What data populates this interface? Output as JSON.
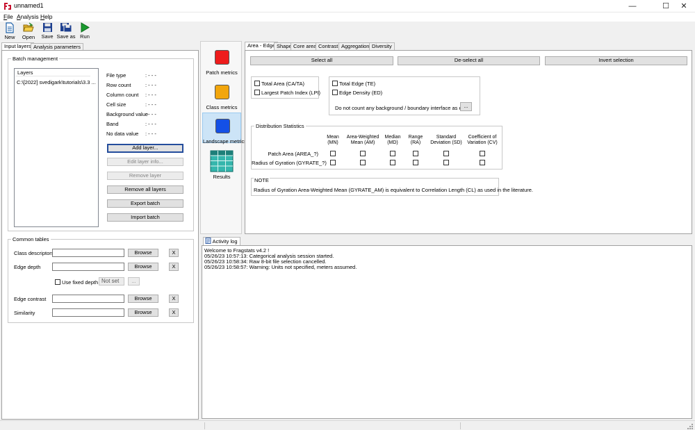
{
  "window": {
    "title": "unnamed1",
    "controls": {
      "minimize": "—",
      "maximize": "☐",
      "close": "✕"
    }
  },
  "menu": [
    {
      "key": "F",
      "rest": "ile"
    },
    {
      "key": "A",
      "rest": "nalysis"
    },
    {
      "key": "H",
      "rest": "elp"
    }
  ],
  "toolbar": {
    "new": "New",
    "open": "Open",
    "save": "Save",
    "save_as": "Save as",
    "run": "Run"
  },
  "left_tabs": {
    "input_layers": "Input layers",
    "analysis_parameters": "Analysis parameters"
  },
  "batch": {
    "title": "Batch management",
    "layers_header": "Layers",
    "layer_path": "C:\\[2022] svedigark\\tutorials\\3.3 ...",
    "info": [
      {
        "label": "File type",
        "value": ": - - -"
      },
      {
        "label": "Row count",
        "value": ": - - -"
      },
      {
        "label": "Column count",
        "value": ": - - -"
      },
      {
        "label": "Cell size",
        "value": ": - - -"
      },
      {
        "label": "Background value",
        "value": ": - - -"
      },
      {
        "label": "Band",
        "value": ": - - -"
      },
      {
        "label": "No data value",
        "value": ": - - -"
      }
    ],
    "buttons": {
      "add_layer": "Add layer...",
      "edit_layer_info": "Edit layer info...",
      "remove_layer": "Remove layer",
      "remove_all_layers": "Remove all layers",
      "export_batch": "Export batch",
      "import_batch": "Import batch"
    }
  },
  "common": {
    "title": "Common tables",
    "class_descriptors": "Class descriptors",
    "edge_depth": "Edge depth",
    "use_fixed_depth": "Use fixed depth",
    "not_set": "Not set",
    "ellipsis": "...",
    "edge_contrast": "Edge contrast",
    "similarity": "Similarity",
    "browse": "Browse",
    "clear": "X"
  },
  "side": {
    "patch": "Patch metrics",
    "class": "Class metrics",
    "landscape": "Landscape metrics",
    "results": "Results"
  },
  "colors": {
    "patch": "#ee1c1c",
    "class": "#f2a60d",
    "landscape": "#1450e6",
    "results": "#1d9a92",
    "selection": "#cce4f7"
  },
  "metric_tabs": [
    "Area - Edge",
    "Shape",
    "Core area",
    "Contrast",
    "Aggregation",
    "Diversity"
  ],
  "selection": {
    "select_all": "Select all",
    "deselect_all": "De-select all",
    "invert": "Invert selection"
  },
  "area_box": {
    "total_area": "Total Area  (CA/TA)",
    "lpi": "Largest Patch Index  (LPI)"
  },
  "edge_box": {
    "total_edge": "Total Edge  (TE)",
    "edge_density": "Edge Density  (ED)",
    "note": "Do not count any background / boundary interface as edge.",
    "ellipsis": "..."
  },
  "distribution": {
    "title": "Distribution Statistics",
    "columns": [
      [
        "Mean",
        "(MN)"
      ],
      [
        "Area-Weighted",
        "Mean (AM)"
      ],
      [
        "Median",
        "(MD)"
      ],
      [
        "Range",
        "(RA)"
      ],
      [
        "Standard",
        "Deviation (SD)"
      ],
      [
        "Coefficient of",
        "Variation (CV)"
      ]
    ],
    "rows": [
      "Patch Area (AREA_?)",
      "Radius of Gyration (GYRATE_?)"
    ]
  },
  "note": {
    "title": "NOTE",
    "text": "Radius of Gyration Area-Weighted Mean (GYRATE_AM) is equivalent to Correlation Length (CL) as used in the literature."
  },
  "activity": {
    "tab": "Activity log",
    "lines": [
      "Welcome to Fragstats v4.2 !",
      "05/26/23 10:57:13: Categorical analysis session started.",
      "05/26/23 10:58:34: Raw 8-bit file selection cancelled.",
      "05/26/23 10:58:57: Warning: Units not specified, meters assumed."
    ]
  }
}
